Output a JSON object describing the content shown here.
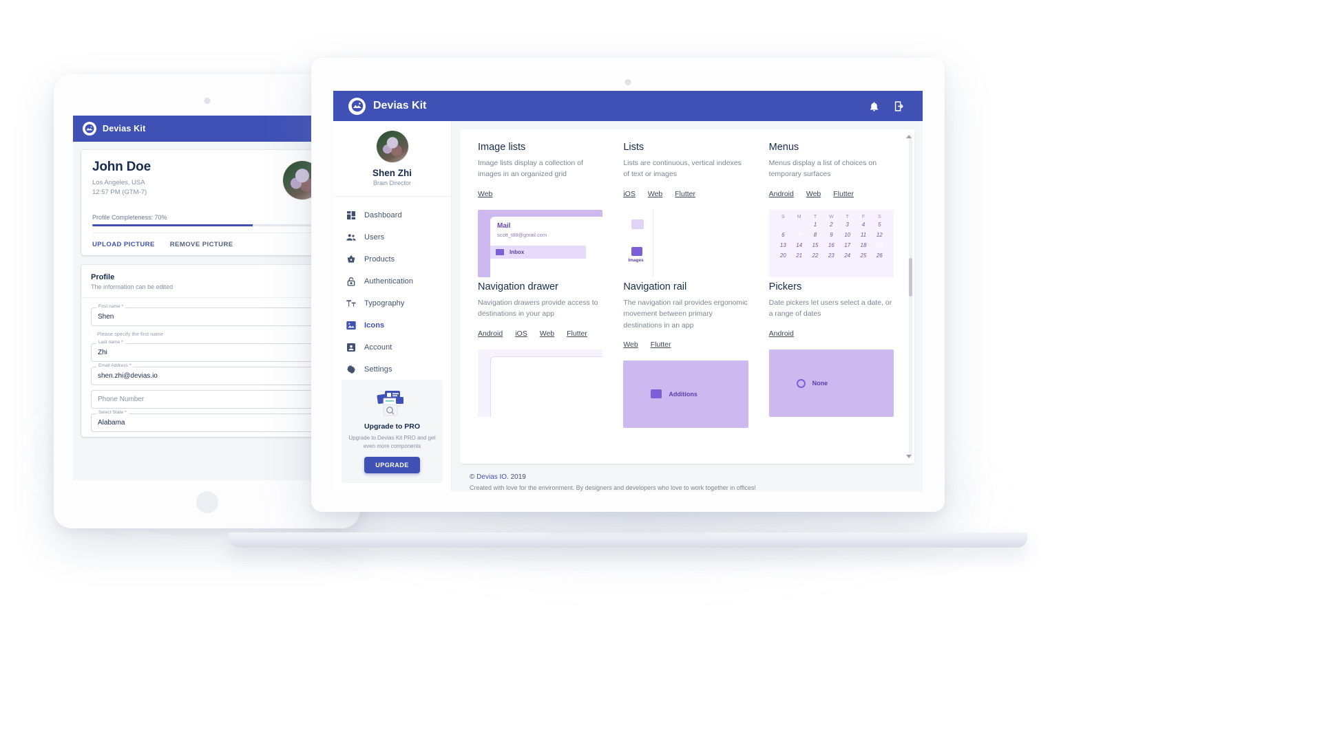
{
  "brand": {
    "name": "Devias Kit",
    "logo_icon": "mountain-logo-icon",
    "accent": "#3f51b5"
  },
  "tablet": {
    "appbar": {
      "title": "Devias Kit",
      "menu_icon": "hamburger-menu-icon"
    },
    "profile_card": {
      "name": "John Doe",
      "location": "Los Angeles, USA",
      "time": "12:57 PM (GTM-7)",
      "completeness_label": "Profile Completeness: 70%",
      "completeness_percent": 70,
      "upload_label": "UPLOAD PICTURE",
      "remove_label": "REMOVE PICTURE",
      "avatar_icon": "user-avatar"
    },
    "form_card": {
      "title": "Profile",
      "subtitle": "The information can be edited",
      "fields": [
        {
          "label": "First name *",
          "value": "Shen",
          "helper": "Please specify the first name",
          "type": "text"
        },
        {
          "label": "Last name *",
          "value": "Zhi",
          "helper": "",
          "type": "text"
        },
        {
          "label": "Email Address *",
          "value": "shen.zhi@devias.io",
          "helper": "",
          "type": "text"
        },
        {
          "label": "",
          "value": "Phone Number",
          "helper": "",
          "type": "placeholder"
        },
        {
          "label": "Select State *",
          "value": "Alabama",
          "helper": "",
          "type": "select"
        }
      ]
    }
  },
  "laptop": {
    "appbar": {
      "title": "Devias Kit",
      "notifications_icon": "bell-icon",
      "logout_icon": "logout-icon"
    },
    "sidebar": {
      "user": {
        "name": "Shen Zhi",
        "role": "Brain Director",
        "avatar_icon": "user-avatar"
      },
      "items": [
        {
          "label": "Dashboard",
          "icon": "dashboard-icon",
          "active": false
        },
        {
          "label": "Users",
          "icon": "users-icon",
          "active": false
        },
        {
          "label": "Products",
          "icon": "basket-icon",
          "active": false
        },
        {
          "label": "Authentication",
          "icon": "lock-icon",
          "active": false
        },
        {
          "label": "Typography",
          "icon": "text-format-icon",
          "active": false
        },
        {
          "label": "Icons",
          "icon": "image-icon",
          "active": true
        },
        {
          "label": "Account",
          "icon": "account-box-icon",
          "active": false
        },
        {
          "label": "Settings",
          "icon": "gear-icon",
          "active": false
        }
      ],
      "upgrade": {
        "title": "Upgrade to PRO",
        "text": "Upgrade to Devias Kit PRO and get even more components",
        "button_label": "UPGRADE",
        "image_icon": "upgrade-illustration-icon"
      }
    },
    "content": {
      "tiles": [
        {
          "title": "Image lists",
          "desc": "Image lists display a collection of images in an organized grid",
          "links": [
            "Web"
          ],
          "art": "mail"
        },
        {
          "title": "Lists",
          "desc": "Lists are continuous, vertical indexes of text or images",
          "links": [
            "iOS",
            "Web",
            "Flutter"
          ],
          "art": "rail"
        },
        {
          "title": "Menus",
          "desc": "Menus display a list of choices on temporary surfaces",
          "links": [
            "Android",
            "Web",
            "Flutter"
          ],
          "art": "calendar"
        },
        {
          "title": "Navigation drawer",
          "desc": "Navigation drawers provide access to destinations in your app",
          "links": [
            "Android",
            "iOS",
            "Web",
            "Flutter"
          ],
          "art": "plain"
        },
        {
          "title": "Navigation rail",
          "desc": "The navigation rail provides ergonomic movement between primary destinations in an app",
          "links": [
            "Web",
            "Flutter"
          ],
          "art": "band-additions"
        },
        {
          "title": "Pickers",
          "desc": "Date pickers let users select a date, or a range of dates",
          "links": [
            "Android"
          ],
          "art": "band-none"
        }
      ],
      "mail_art": {
        "title": "Mail",
        "address": "scott_t88@gmail.com",
        "row_label": "Inbox",
        "mail_icon": "envelope-icon"
      },
      "rail_art": {
        "caption": "Images",
        "icon": "images-icon"
      },
      "calendar_art": {
        "weekdays": [
          "S",
          "M",
          "T",
          "W",
          "T",
          "F",
          "S"
        ],
        "rows": [
          [
            "",
            "",
            "1",
            "2",
            "3",
            "4",
            "5"
          ],
          [
            "6",
            "7",
            "8",
            "9",
            "10",
            "11",
            "12"
          ],
          [
            "13",
            "14",
            "15",
            "16",
            "17",
            "18",
            "19"
          ],
          [
            "20",
            "21",
            "22",
            "23",
            "24",
            "25",
            "26"
          ]
        ],
        "selected": [
          "7",
          "19"
        ]
      },
      "band_additions": {
        "label": "Additions",
        "icon": "square-icon"
      },
      "band_none": {
        "label": "None",
        "icon": "circle-icon"
      },
      "scrollbar": {
        "up_icon": "scroll-up-icon",
        "down_icon": "scroll-down-icon"
      }
    },
    "footer": {
      "copyright_symbol": "©",
      "company": "Devias IO",
      "year": ". 2019",
      "note": "Created with love for the environment. By designers and developers who love to work together in offices!"
    }
  }
}
